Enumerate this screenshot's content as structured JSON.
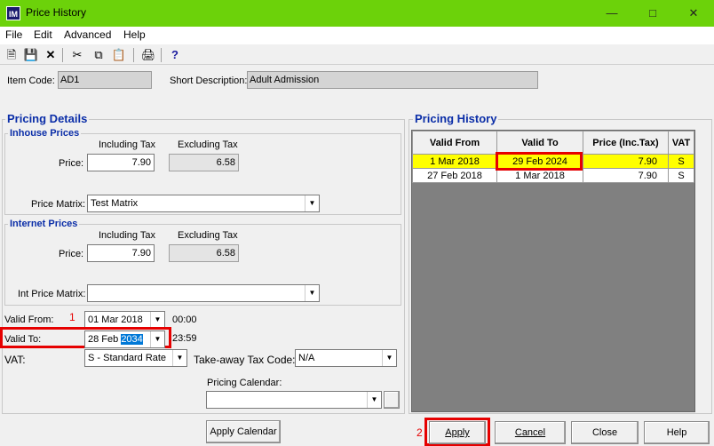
{
  "window": {
    "title": "Price History",
    "app_icon": "IM"
  },
  "menu": [
    {
      "label": "File"
    },
    {
      "label": "Edit"
    },
    {
      "label": "Advanced"
    },
    {
      "label": "Help"
    }
  ],
  "header": {
    "item_code_label": "Item Code:",
    "item_code": "AD1",
    "short_desc_label": "Short Description:",
    "short_desc": "Adult Admission"
  },
  "pricing": {
    "title": "Pricing Details",
    "inhouse": {
      "title": "Inhouse Prices",
      "incl_header": "Including Tax",
      "excl_header": "Excluding Tax",
      "price_label": "Price:",
      "price_incl": "7.90",
      "price_excl": "6.58",
      "matrix_label": "Price Matrix:",
      "matrix": "Test Matrix"
    },
    "internet": {
      "title": "Internet Prices",
      "incl_header": "Including Tax",
      "excl_header": "Excluding Tax",
      "price_label": "Price:",
      "price_incl": "7.90",
      "price_excl": "6.58",
      "matrix_label": "Int Price Matrix:",
      "matrix": ""
    },
    "valid_from_label": "Valid From:",
    "valid_from": "01 Mar 2018",
    "valid_from_time": "00:00",
    "valid_to_label": "Valid To:",
    "valid_to_prefix": "28 Feb ",
    "valid_to_year": "2034",
    "valid_to_time": "23:59",
    "vat_label": "VAT:",
    "vat": "S - Standard Rate",
    "takeaway_label": "Take-away Tax Code:",
    "takeaway": "N/A",
    "calendar_label": "Pricing Calendar:",
    "calendar": ""
  },
  "history": {
    "title": "Pricing History",
    "columns": [
      "Valid From",
      "Valid To",
      "Price (Inc.Tax)",
      "VAT"
    ],
    "rows": [
      {
        "valid_from": "1 Mar 2018",
        "valid_to": "29 Feb 2024",
        "price": "7.90",
        "vat": "S"
      },
      {
        "valid_from": "27 Feb 2018",
        "valid_to": "1 Mar 2018",
        "price": "7.90",
        "vat": "S"
      }
    ]
  },
  "annotations": {
    "marker_1": "1",
    "marker_2": "2"
  },
  "buttons": {
    "apply_calendar": "Apply Calendar",
    "apply": "Apply",
    "cancel": "Cancel",
    "close": "Close",
    "help": "Help"
  },
  "colors": {
    "titlebar": "#6cd20a",
    "accent_text": "#0b2ea8",
    "highlight_row": "#ffff00",
    "annotation": "#e60000"
  }
}
